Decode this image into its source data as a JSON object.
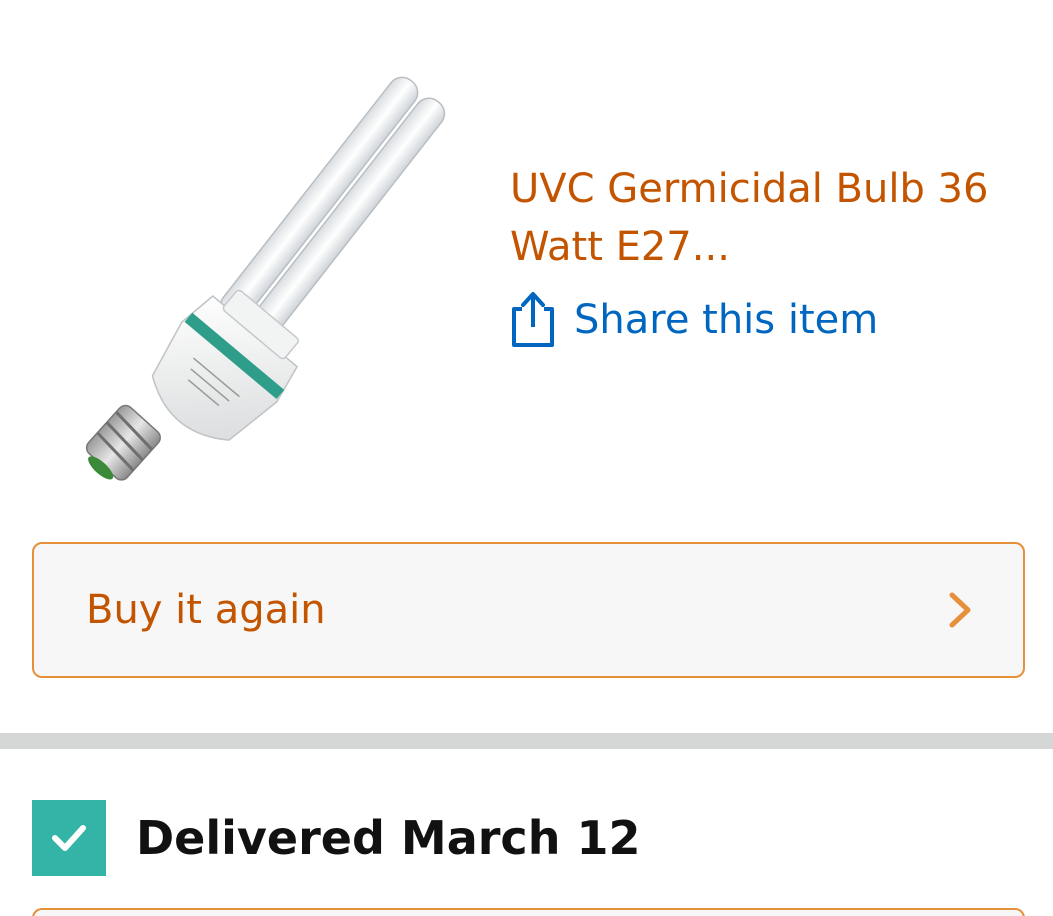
{
  "product": {
    "image_icon": "uvc-bulb-image",
    "title": "UVC Germicidal Bulb 36 Watt E27...",
    "share_label": "Share this item",
    "share_icon": "share-icon"
  },
  "actions": {
    "buy_again_label": "Buy it again",
    "buy_again_icon": "chevron-right-icon"
  },
  "delivery": {
    "status_icon": "check-icon",
    "status_text": "Delivered March 12"
  },
  "colors": {
    "link_orange": "#c45500",
    "link_blue": "#0066c0",
    "button_border": "#e7903c",
    "button_bg": "#f7f7f7",
    "check_teal": "#34b4a6",
    "divider_gray": "#d5d6d6",
    "text_dark": "#111111"
  }
}
